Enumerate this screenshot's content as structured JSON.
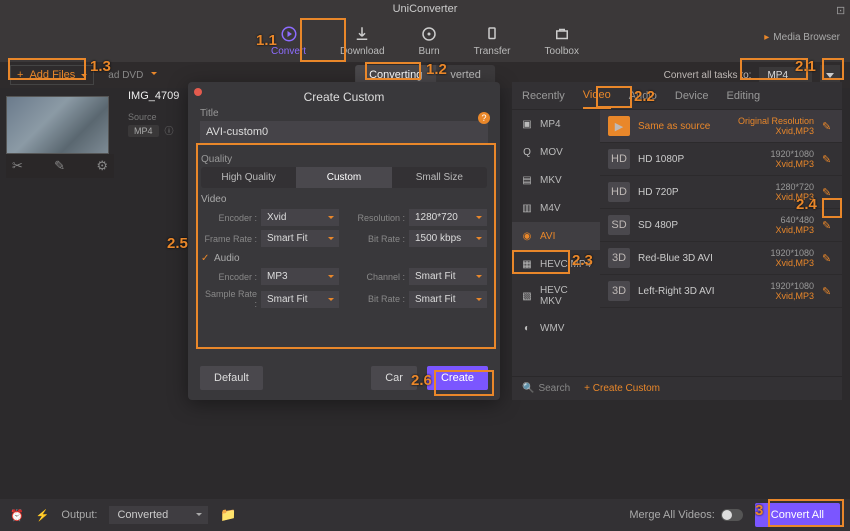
{
  "app_title": "UniConverter",
  "nav": [
    {
      "label": "Convert",
      "active": true
    },
    {
      "label": "Download",
      "active": false
    },
    {
      "label": "Burn",
      "active": false
    },
    {
      "label": "Transfer",
      "active": false
    },
    {
      "label": "Toolbox",
      "active": false
    }
  ],
  "media_browser": "Media Browser",
  "add_files": "Add Files",
  "load_dvd": "ad DVD",
  "mode_tabs": {
    "converting": "Converting",
    "converted": "verted"
  },
  "convert_all_label": "Convert all tasks to:",
  "convert_all_format": "MP4",
  "file": {
    "name": "IMG_4709",
    "source_label": "Source",
    "source_val": "MP4"
  },
  "thumb_tools": [
    "✂",
    "✎",
    "⚙"
  ],
  "modal": {
    "title": "Create Custom",
    "title_label": "Title",
    "title_value": "AVI-custom0",
    "quality_label": "Quality",
    "quality_tabs": [
      "High Quality",
      "Custom",
      "Small Size"
    ],
    "video_label": "Video",
    "audio_label": "Audio",
    "video": {
      "encoder_label": "Encoder :",
      "encoder": "Xvid",
      "resolution_label": "Resolution :",
      "resolution": "1280*720",
      "framerate_label": "Frame Rate :",
      "framerate": "Smart Fit",
      "bitrate_label": "Bit Rate :",
      "bitrate": "1500 kbps"
    },
    "audio": {
      "encoder_label": "Encoder :",
      "encoder": "MP3",
      "channel_label": "Channel :",
      "channel": "Smart Fit",
      "samplerate_label": "Sample Rate :",
      "samplerate": "Smart Fit",
      "bitrate_label": "Bit Rate :",
      "bitrate": "Smart Fit"
    },
    "btn_default": "Default",
    "btn_cancel": "Car",
    "btn_create": "Create"
  },
  "panel": {
    "tabs": [
      "Recently",
      "Video",
      "Audio",
      "Device",
      "Editing"
    ],
    "formats": [
      "MP4",
      "MOV",
      "MKV",
      "M4V",
      "AVI",
      "HEVC MP4",
      "HEVC MKV",
      "WMV"
    ],
    "presets": [
      {
        "name": "Same as source",
        "res": "Original Resolution",
        "sub": "Xvid,MP3",
        "active": true
      },
      {
        "name": "HD 1080P",
        "res": "1920*1080",
        "sub": "Xvid,MP3"
      },
      {
        "name": "HD 720P",
        "res": "1280*720",
        "sub": "Xvid,MP3"
      },
      {
        "name": "SD 480P",
        "res": "640*480",
        "sub": "Xvid,MP3"
      },
      {
        "name": "Red-Blue 3D AVI",
        "res": "1920*1080",
        "sub": "Xvid,MP3"
      },
      {
        "name": "Left-Right 3D AVI",
        "res": "1920*1080",
        "sub": "Xvid,MP3"
      }
    ],
    "search": "Search",
    "create_custom": "Create Custom"
  },
  "footer": {
    "output_label": "Output:",
    "output_value": "Converted",
    "merge_label": "Merge All Videos:",
    "convert_all": "Convert All"
  },
  "annotations": {
    "a11": "1.1",
    "a12": "1.2",
    "a13": "1.3",
    "a21": "2.1",
    "a22": "2.2",
    "a23": "2.3",
    "a24": "2.4",
    "a25": "2.5",
    "a26": "2.6",
    "a3": "3"
  }
}
